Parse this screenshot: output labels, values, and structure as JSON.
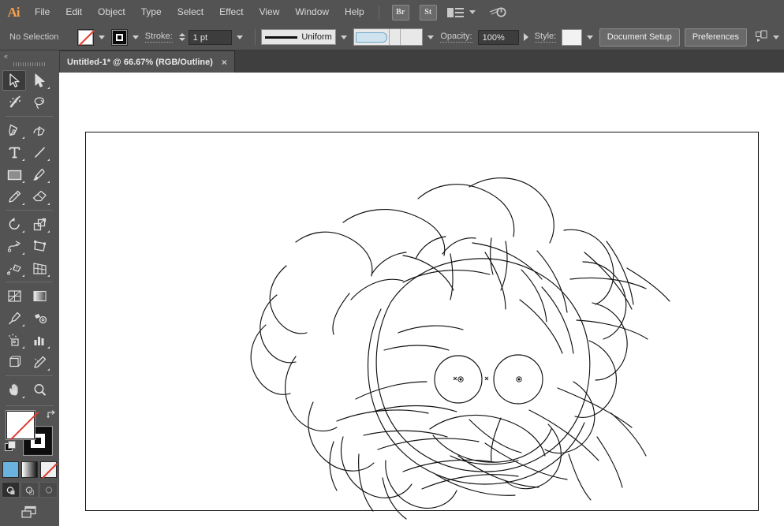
{
  "app": {
    "name": "Adobe Illustrator",
    "logo_text": "Ai"
  },
  "menubar": {
    "items": [
      {
        "label": "File"
      },
      {
        "label": "Edit"
      },
      {
        "label": "Object"
      },
      {
        "label": "Type"
      },
      {
        "label": "Select"
      },
      {
        "label": "Effect"
      },
      {
        "label": "View"
      },
      {
        "label": "Window"
      },
      {
        "label": "Help"
      }
    ],
    "bridge_label": "Br",
    "stock_label": "St",
    "workspace_icon": "workspace-switcher-icon",
    "search_icon": "search-adobe-stock-icon"
  },
  "controlbar": {
    "selection_status": "No Selection",
    "fill_icon": "fill-none-swatch",
    "stroke_icon": "stroke-black-swatch",
    "stroke_label": "Stroke:",
    "stroke_weight": "1 pt",
    "stroke_profile": "Uniform",
    "width_profile_icon": "variable-width-profile",
    "opacity_label": "Opacity:",
    "opacity_value": "100%",
    "style_label": "Style:",
    "document_setup_label": "Document Setup",
    "preferences_label": "Preferences",
    "align_icon": "align-to-selection-icon"
  },
  "tabbar": {
    "document_title": "Untitled-1* @ 66.67% (RGB/Outline)",
    "close_label": "×"
  },
  "toolbar": {
    "collapse_icon": "collapse-panel-chevrons",
    "tools": [
      {
        "name": "selection-tool",
        "active": true,
        "flyout": false
      },
      {
        "name": "direct-selection-tool",
        "active": false,
        "flyout": true
      },
      {
        "name": "magic-wand-tool",
        "active": false,
        "flyout": false
      },
      {
        "name": "lasso-tool",
        "active": false,
        "flyout": false
      },
      {
        "name": "pen-tool",
        "active": false,
        "flyout": true
      },
      {
        "name": "curvature-tool",
        "active": false,
        "flyout": false
      },
      {
        "name": "type-tool",
        "active": false,
        "flyout": true
      },
      {
        "name": "line-segment-tool",
        "active": false,
        "flyout": true
      },
      {
        "name": "rectangle-tool",
        "active": false,
        "flyout": true
      },
      {
        "name": "paintbrush-tool",
        "active": false,
        "flyout": true
      },
      {
        "name": "pencil-tool",
        "active": false,
        "flyout": true
      },
      {
        "name": "eraser-tool",
        "active": false,
        "flyout": true
      },
      {
        "name": "rotate-tool",
        "active": false,
        "flyout": true
      },
      {
        "name": "scale-tool",
        "active": false,
        "flyout": true
      },
      {
        "name": "width-tool",
        "active": false,
        "flyout": true
      },
      {
        "name": "free-transform-tool",
        "active": false,
        "flyout": false
      },
      {
        "name": "shape-builder-tool",
        "active": false,
        "flyout": true
      },
      {
        "name": "perspective-grid-tool",
        "active": false,
        "flyout": true
      },
      {
        "name": "mesh-tool",
        "active": false,
        "flyout": false
      },
      {
        "name": "gradient-tool",
        "active": false,
        "flyout": false
      },
      {
        "name": "eyedropper-tool",
        "active": false,
        "flyout": true
      },
      {
        "name": "blend-tool",
        "active": false,
        "flyout": false
      },
      {
        "name": "symbol-sprayer-tool",
        "active": false,
        "flyout": true
      },
      {
        "name": "column-graph-tool",
        "active": false,
        "flyout": true
      },
      {
        "name": "artboard-tool",
        "active": false,
        "flyout": false
      },
      {
        "name": "slice-tool",
        "active": false,
        "flyout": true
      },
      {
        "name": "hand-tool",
        "active": false,
        "flyout": true
      },
      {
        "name": "zoom-tool",
        "active": false,
        "flyout": false
      }
    ],
    "fill_swatch": "fill-none",
    "stroke_swatch": "stroke-black",
    "swap_icon": "swap-fill-stroke-icon",
    "default_icon": "default-fill-stroke-icon",
    "color_modes": [
      {
        "name": "color-button"
      },
      {
        "name": "gradient-button"
      },
      {
        "name": "none-button"
      }
    ],
    "draw_modes": [
      {
        "name": "draw-normal-button",
        "active": true
      },
      {
        "name": "draw-behind-button",
        "active": false
      },
      {
        "name": "draw-inside-button",
        "active": false
      }
    ],
    "screen_mode": "change-screen-mode-button"
  },
  "canvas": {
    "zoom_level": "66.67%",
    "view_mode": "Outline",
    "color_mode": "RGB",
    "artwork_name": "hand-drawn-face-sketch",
    "stroke_color": "#111111",
    "background_color": "#ffffff"
  },
  "colors": {
    "chrome": "#535353",
    "chrome_dark": "#3f3f3f",
    "accent_orange": "#f7a04b",
    "none_red": "#e23b2e",
    "text": "#d4d4d4"
  }
}
